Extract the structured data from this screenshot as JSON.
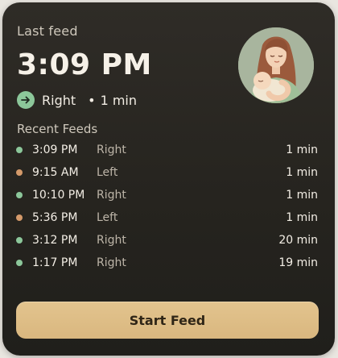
{
  "last_feed": {
    "label": "Last feed",
    "time": "3:09 PM",
    "side": "Right",
    "separator": "•",
    "duration": "1 min"
  },
  "recent": {
    "title": "Recent Feeds",
    "items": [
      {
        "time": "3:09 PM",
        "side": "Right",
        "duration": "1 min",
        "dot_color": "#8cc79a"
      },
      {
        "time": "9:15 AM",
        "side": "Left",
        "duration": "1 min",
        "dot_color": "#d49a6a"
      },
      {
        "time": "10:10 PM",
        "side": "Right",
        "duration": "1 min",
        "dot_color": "#8cc79a"
      },
      {
        "time": "5:36 PM",
        "side": "Left",
        "duration": "1 min",
        "dot_color": "#d49a6a"
      },
      {
        "time": "3:12 PM",
        "side": "Right",
        "duration": "20 min",
        "dot_color": "#8cc79a"
      },
      {
        "time": "1:17 PM",
        "side": "Right",
        "duration": "19 min",
        "dot_color": "#8cc79a"
      }
    ]
  },
  "action": {
    "start_label": "Start Feed"
  },
  "colors": {
    "right": "#8cc79a",
    "left": "#d49a6a",
    "button": "#dfbd86",
    "card": "#2a2823"
  },
  "icons": {
    "side_indicator": "arrow-right-icon",
    "illustration": "mother-baby-illustration"
  }
}
